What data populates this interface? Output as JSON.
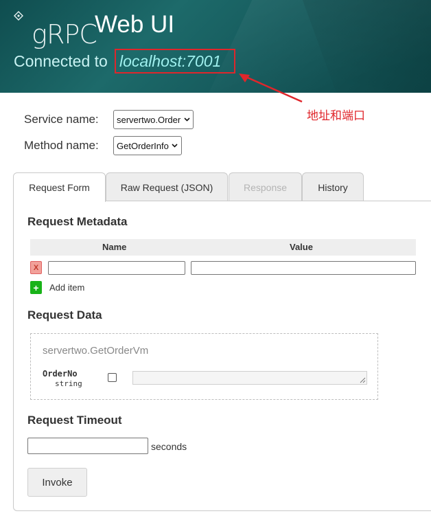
{
  "header": {
    "logo_g": "g",
    "logo_rpc": "RPC",
    "app_title": "Web UI",
    "connected_prefix": "Connected to",
    "address": "localhost:7001",
    "highlight_color": "#e0262b"
  },
  "annotation": {
    "text": "地址和端口"
  },
  "form": {
    "service_label": "Service name:",
    "service_value": "servertwo.Order",
    "method_label": "Method name:",
    "method_value": "GetOrderInfo"
  },
  "tabs": [
    {
      "label": "Request Form",
      "state": "active"
    },
    {
      "label": "Raw Request (JSON)",
      "state": "normal"
    },
    {
      "label": "Response",
      "state": "disabled"
    },
    {
      "label": "History",
      "state": "normal"
    }
  ],
  "metadata": {
    "title": "Request Metadata",
    "col_name": "Name",
    "col_value": "Value",
    "remove_label": "X",
    "add_icon": "+",
    "add_label": "Add item"
  },
  "request_data": {
    "title": "Request Data",
    "message_type": "servertwo.GetOrderVm",
    "field_name": "OrderNo",
    "field_type": "string"
  },
  "timeout": {
    "title": "Request Timeout",
    "unit": "seconds"
  },
  "invoke_label": "Invoke"
}
